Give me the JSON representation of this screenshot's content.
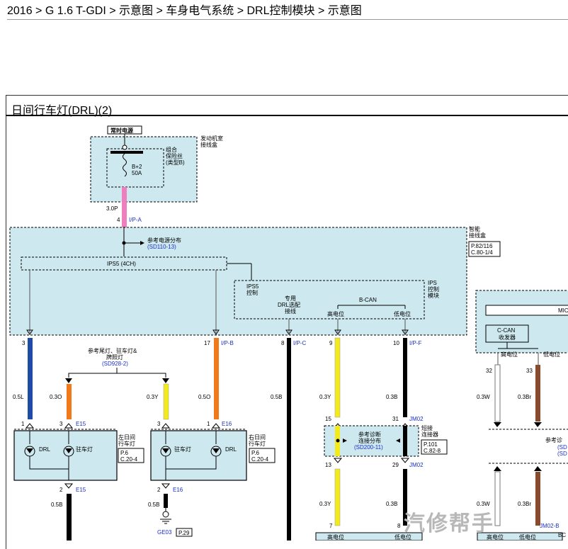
{
  "breadcrumb": "2016 > G 1.6 T-GDI > 示意图 > 车身电气系统 > DRL控制模块 > 示意图",
  "diagram": {
    "title": "日间行车灯(DRL)(2)",
    "constant_power": "常时电源",
    "engine_box": [
      "发动机室",
      "接线盒"
    ],
    "fuse_type": [
      "组合",
      "保险丝",
      "(类型B)"
    ],
    "fuse_name": "B+2",
    "fuse_rating": "50A",
    "wire_top": "3.0P",
    "pin_top": "4",
    "conn_top": "I/P-A",
    "ref_power": "参考电源分布",
    "ref_power_code": "(SD110-13)",
    "smart_box": [
      "智能",
      "接线盒"
    ],
    "smart_ref": [
      "P.82/116",
      "C.80-1/4"
    ],
    "ips5": "IPS5 (4CH)",
    "ips5_ctrl": [
      "IPS5",
      "控制"
    ],
    "drl_dedicated": [
      "专用",
      "DRL选配",
      "接线"
    ],
    "bcan": "B-CAN",
    "high": "高电位",
    "low": "低电位",
    "ips_module": [
      "IPS",
      "控制",
      "模块"
    ],
    "pin3": "3",
    "pin17": "17",
    "conn_ipb": "I/P-B",
    "pin8": "8",
    "conn_ipc": "I/P-C",
    "pin9": "9",
    "pin10": "10",
    "conn_ipf": "I/P-F",
    "ref_tail": [
      "参考尾灯、驻车灯&",
      "牌照灯"
    ],
    "ref_tail_code": "(SD928-2)",
    "w_05L": "0.5L",
    "w_03O": "0.3O",
    "w_03Y": "0.3Y",
    "w_05O": "0.5O",
    "w_05B": "0.5B",
    "w_03Y2": "0.3Y",
    "w_03B": "0.3B",
    "left_lamp": [
      "左日间",
      "行车灯"
    ],
    "right_lamp": [
      "右日间",
      "行车灯"
    ],
    "lamp_ref": [
      "P.6",
      "C.20-4"
    ],
    "drl": "DRL",
    "park_lamp": "驻车灯",
    "pin1": "1",
    "pin3b": "3",
    "conn_e15": "E15",
    "conn_e16": "E16",
    "pin2": "2",
    "ground": "GE03",
    "ground_ref": "P.29",
    "pin15": "15",
    "pin31": "31",
    "conn_jm02": "JM02",
    "pin13": "13",
    "pin29": "29",
    "pin7": "7",
    "pin8b": "8",
    "diag_ref": [
      "参考诊断",
      "连接分布"
    ],
    "diag_code": "(SD200-11)",
    "short_conn": [
      "短接",
      "连接器"
    ],
    "short_ref": [
      "P.101",
      "C.82-8"
    ],
    "mic": "MIC",
    "ccan": [
      "C-CAN",
      "收发器"
    ],
    "pin32": "32",
    "pin33": "33",
    "w_03W": "0.3W",
    "w_03Br": "0.3Br",
    "ref_cut": "参考诊",
    "ref_cut2": "(SD",
    "ref_cut3": "(SD",
    "jm02b": "JM02-B",
    "bc": "BC",
    "watermark": "汽修帮手"
  },
  "colors": {
    "pink": "#ee7fbf",
    "blue": "#1f4aa6",
    "orange": "#f07a1a",
    "yellow": "#f2ea1b",
    "black": "#000000",
    "brown": "#8a4a2c",
    "white": "#ffffff",
    "box_fill": "#cde8ee"
  }
}
